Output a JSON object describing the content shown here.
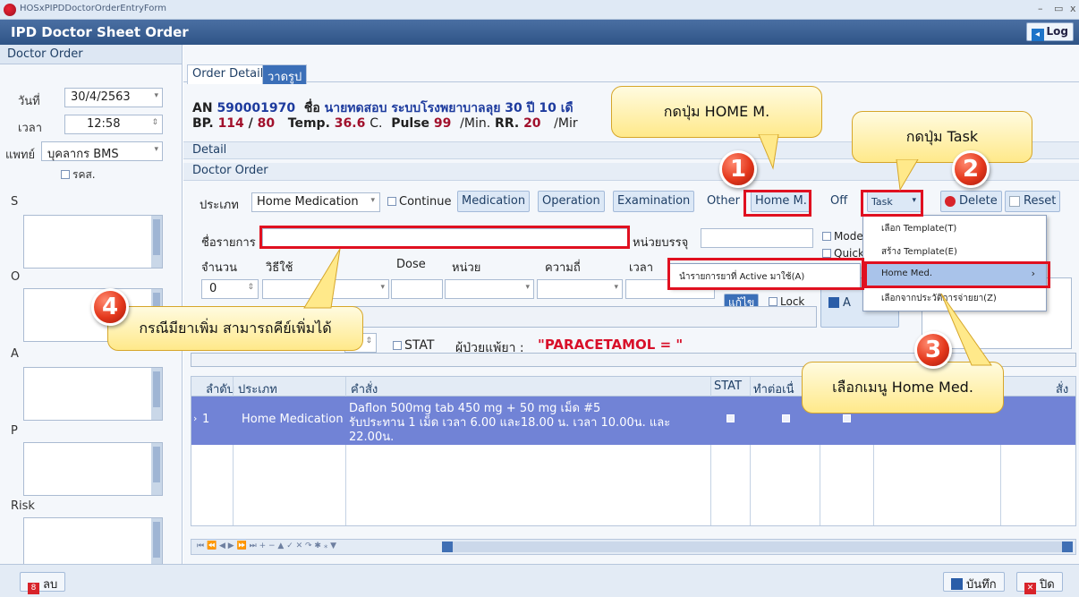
{
  "window": {
    "title": "HOSxPIPDDoctorOrderEntryForm",
    "minimize": "–",
    "maximize": "▭",
    "close": "x"
  },
  "header": {
    "title": "IPD Doctor Sheet Order",
    "logout": "Log"
  },
  "left": {
    "title": "Doctor Order",
    "date_label": "วันที่",
    "date_value": "30/4/2563",
    "time_label": "เวลา",
    "time_value": "12:58",
    "doctor_label": "แพทย์",
    "doctor_value": "บุคลากร BMS",
    "rks_label": "รคส.",
    "soap": [
      "S",
      "O",
      "A",
      "P",
      "Risk"
    ]
  },
  "tabs": [
    "Order Detail",
    "วาดรูป"
  ],
  "patient": {
    "an_label": "AN",
    "an": "590001970",
    "name_label": "ชื่อ",
    "name": "นายทดสอบ ระบบโรงพยาบาลลุย 30 ปี 10 เดื",
    "bp_label": "BP.",
    "bp_sys": "114",
    "bp_dia": "80",
    "temp_label": "Temp.",
    "temp": "36.6",
    "temp_unit": "C.",
    "pulse_label": "Pulse",
    "pulse": "99",
    "pulse_unit": "/Min.",
    "rr_label": "RR.",
    "rr": "20",
    "rr_unit": "/Mir"
  },
  "sections": {
    "detail": "Detail",
    "doctor_order": "Doctor Order"
  },
  "toolbar": {
    "type_label": "ประเภท",
    "type_value": "Home Medication",
    "continue": "Continue",
    "medication": "Medication",
    "operation": "Operation",
    "examination": "Examination",
    "other": "Other",
    "home_m": "Home M.",
    "off": "Off",
    "task": "Task",
    "delete": "Delete",
    "reset": "Reset"
  },
  "form": {
    "item_label": "ชื่อรายการ",
    "unit_pack_label": "หน่วยบรรจุ",
    "mode": "Mode",
    "quick": "Quick",
    "qty_label": "จำนวน",
    "route_label": "วิธีใช้",
    "dose_label": "Dose",
    "unit_label": "หน่วย",
    "freq_label": "ความถี่",
    "time_label": "เวลา",
    "qty_value": "0",
    "edit_btn": "แก้ไข",
    "lock": "Lock",
    "add_btn": "A",
    "stat": "STAT",
    "allergy_label": "ผู้ป่วยแพ้ยา :",
    "allergy_value": "\"PARACETAMOL = \""
  },
  "grid": {
    "headers": [
      "ลำดับ",
      "ประเภท",
      "คำสั่ง",
      "STAT",
      "ทำต่อเนื่",
      "สั่ง"
    ],
    "row": {
      "index": "1",
      "type": "Home Medication",
      "order_line1": "Daflon 500mg tab 450 mg + 50 mg เม็ด    #5",
      "order_line2": "รับประทาน 1 เม็ด เวลา 6.00 และ18.00 น. เวลา 10.00น. และ",
      "order_line3": "22.00น."
    },
    "nav": "⏮ ⏪ ◀ ▶ ⏩ ⏭ + − ▲ ✓ ✕ ↷ ✱ ⁎ ▼"
  },
  "menu": {
    "items": [
      "เลือก Template(T)",
      "สร้าง Template(E)",
      "Home Med.",
      "เลือกจากประวัติการจ่ายยา(Z)"
    ],
    "submenu": "นำรายการยาที่ Active มาใช้(A)"
  },
  "callouts": {
    "c1": "กดปุ่ม HOME M.",
    "c2": "กดปุ่ม Task",
    "c3": "เลือกเมนู Home Med.",
    "c4": "กรณีมียาเพิ่ม สามารถคีย์เพิ่มได้",
    "n1": "1",
    "n2": "2",
    "n3": "3",
    "n4": "4"
  },
  "bottom": {
    "delete": "ลบ",
    "save": "บันทึก",
    "close": "ปิด"
  },
  "colors": {
    "annotation_red": "#e01020",
    "header_blue": "#2f5486",
    "row_selected": "#7183d6"
  }
}
